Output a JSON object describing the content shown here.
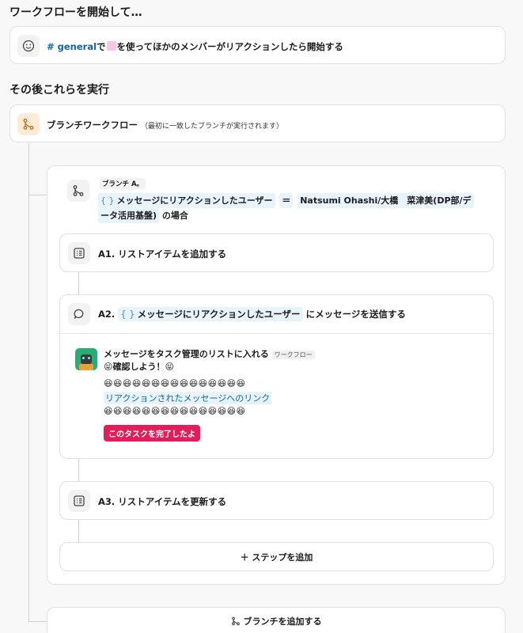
{
  "header1": "ワークフローを開始して…",
  "trigger": {
    "channel": "# general",
    "particle": "で",
    "text": "を使ってほかのメンバーがリアクションしたら開始する"
  },
  "header2": "その後これらを実行",
  "branch_workflow": {
    "title": "ブランチワークフロー",
    "note": "（最初に一致したブランチが実行されます）"
  },
  "branch_a": {
    "label": "ブランチ A。",
    "var_chip": "メッセージにリアクションしたユーザー",
    "equals": "＝",
    "value_line1": "Natsumi Ohashi/大橋　菜津美(DP部/デ",
    "value_line2": "ータ活用基盤)",
    "suffix": "の場合"
  },
  "step_a1": "A1. リストアイテムを追加する",
  "step_a2": {
    "prefix": "A2.",
    "chip": "メッセージにリアクションしたユーザー",
    "suffix": "にメッセージを送信する"
  },
  "message": {
    "sender": "メッセージをタスク管理のリストに入れる",
    "tag": "ワークフロー",
    "line1_emoji_l": "😝",
    "line1": "確認しよう！",
    "line1_emoji_r": "😝",
    "emoji_row1": "😆😆😆😆😆😆😆😆😆😆😆😆😆😆😆",
    "link_text": "リアクションされたメッセージへのリンク",
    "emoji_row2": "😆😆😆😆😆😆😆😆😆😆😆😆😆😆😆",
    "button": "このタスクを完了したよ"
  },
  "step_a3": "A3. リストアイテムを更新する",
  "add_step": "＋ ステップを追加",
  "add_branch": "ブランチを追加する",
  "colors": {
    "accent": "#1264a3",
    "button": "#e01e5a",
    "branch_icon": "#e8912d"
  }
}
